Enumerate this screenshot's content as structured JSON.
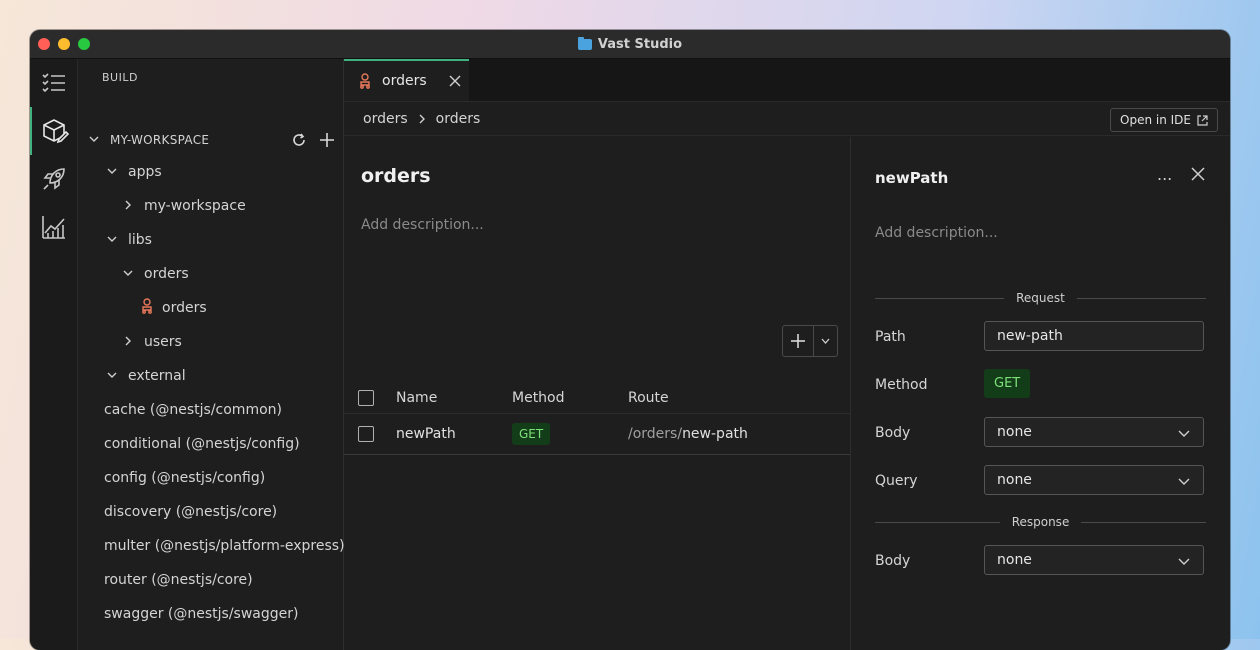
{
  "window": {
    "title": "Vast Studio"
  },
  "sidebar": {
    "header": "BUILD",
    "workspace": "MY-WORKSPACE",
    "tree": [
      {
        "label": "apps",
        "indent": 1,
        "chevron": "down"
      },
      {
        "label": "my-workspace",
        "indent": 2,
        "chevron": "right"
      },
      {
        "label": "libs",
        "indent": 1,
        "chevron": "down"
      },
      {
        "label": "orders",
        "indent": 2,
        "chevron": "down"
      },
      {
        "label": "orders",
        "indent": 3,
        "chevron": "none",
        "icon": "controller-icon"
      },
      {
        "label": "users",
        "indent": 2,
        "chevron": "right"
      },
      {
        "label": "external",
        "indent": 1,
        "chevron": "down"
      },
      {
        "label": "cache (@nestjs/common)",
        "indent": 1,
        "chevron": "none"
      },
      {
        "label": "conditional (@nestjs/config)",
        "indent": 1,
        "chevron": "none"
      },
      {
        "label": "config (@nestjs/config)",
        "indent": 1,
        "chevron": "none"
      },
      {
        "label": "discovery (@nestjs/core)",
        "indent": 1,
        "chevron": "none"
      },
      {
        "label": "multer (@nestjs/platform-express)",
        "indent": 1,
        "chevron": "none"
      },
      {
        "label": "router (@nestjs/core)",
        "indent": 1,
        "chevron": "none"
      },
      {
        "label": "swagger (@nestjs/swagger)",
        "indent": 1,
        "chevron": "none"
      }
    ]
  },
  "tabs": [
    {
      "label": "orders"
    }
  ],
  "breadcrumb": {
    "first": "orders",
    "second": "orders"
  },
  "toolbar": {
    "open_ide": "Open in IDE"
  },
  "center": {
    "title": "orders",
    "description_placeholder": "Add description...",
    "columns": {
      "name": "Name",
      "method": "Method",
      "route": "Route"
    },
    "rows": [
      {
        "name": "newPath",
        "method": "GET",
        "route_prefix": "/orders/",
        "route_path": "new-path"
      }
    ]
  },
  "panel": {
    "title": "newPath",
    "more": "...",
    "description_placeholder": "Add description...",
    "request_label": "Request",
    "response_label": "Response",
    "path_label": "Path",
    "path_value": "new-path",
    "method_label": "Method",
    "method_value": "GET",
    "body_label": "Body",
    "body_value": "none",
    "query_label": "Query",
    "query_value": "none",
    "response_body_label": "Body",
    "response_body_value": "none"
  },
  "colors": {
    "accent": "#3fb27f",
    "get_badge_bg": "#133d18",
    "get_badge_text": "#7ee07a",
    "controller_icon": "#e8785a"
  }
}
